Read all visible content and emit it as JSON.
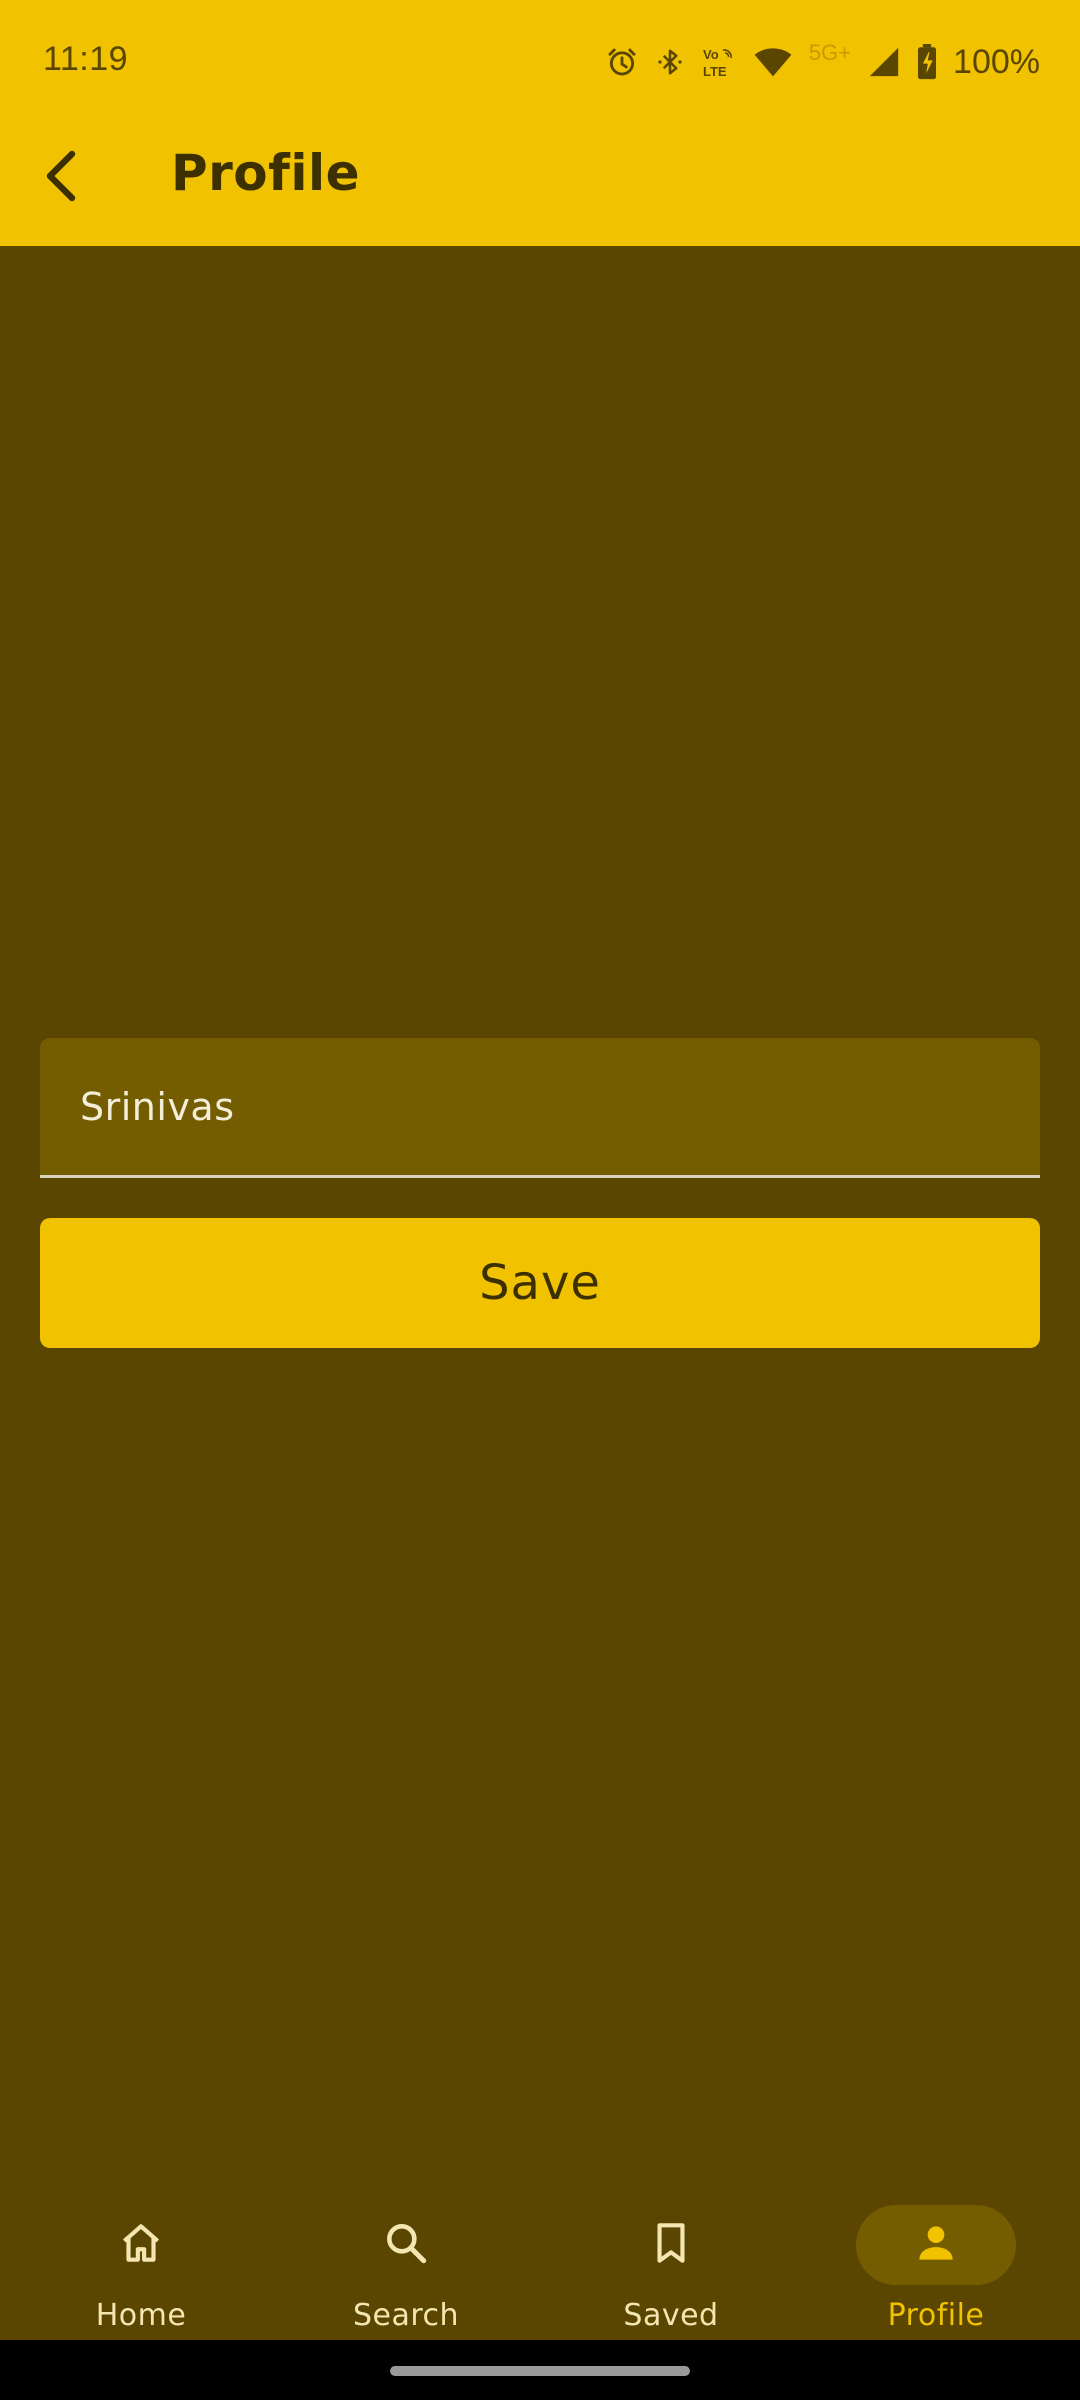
{
  "status_bar": {
    "time": "11:19",
    "network_label": "5G+",
    "battery_text": "100%",
    "icons": [
      "alarm-icon",
      "bluetooth-icon",
      "volte-icon",
      "wifi-icon",
      "signal-icon",
      "battery-charging-icon"
    ]
  },
  "app_bar": {
    "title": "Profile",
    "back_icon": "chevron-left-icon"
  },
  "form": {
    "name_value": "Srinivas",
    "save_label": "Save"
  },
  "bottom_nav": {
    "items": [
      {
        "label": "Home",
        "icon": "home-icon",
        "active": false
      },
      {
        "label": "Search",
        "icon": "search-icon",
        "active": false
      },
      {
        "label": "Saved",
        "icon": "bookmark-icon",
        "active": false
      },
      {
        "label": "Profile",
        "icon": "person-icon",
        "active": true
      }
    ]
  },
  "colors": {
    "accent": "#f0c200",
    "background": "#5a4600",
    "field_background": "#745c00",
    "on_accent_text": "#3d3000"
  }
}
